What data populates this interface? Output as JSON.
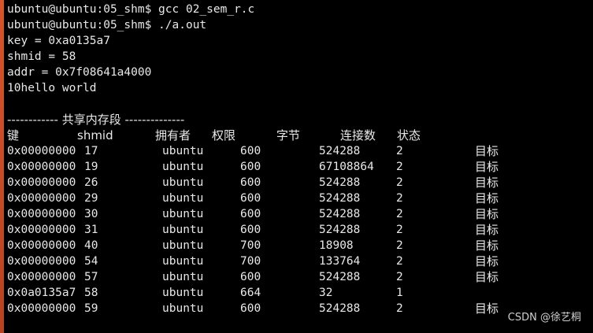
{
  "terminal": {
    "lines": [
      "ubuntu@ubuntu:05_shm$ gcc 02_sem_r.c",
      "ubuntu@ubuntu:05_shm$ ./a.out",
      "key = 0xa0135a7",
      "shmid = 58",
      "addr = 0x7f08641a4000",
      "10hello world",
      "",
      "------------ 共享内存段 --------------"
    ],
    "headers": {
      "key": "键",
      "shmid": "shmid",
      "owner": "拥有者",
      "perms": "权限",
      "bytes": "字节",
      "nattch": "连接数",
      "status": "状态"
    },
    "rows": [
      {
        "key": "0x00000000",
        "shmid": "17",
        "owner": "ubuntu",
        "perms": "600",
        "bytes": "524288",
        "nattch": "2",
        "status": "目标"
      },
      {
        "key": "0x00000000",
        "shmid": "19",
        "owner": "ubuntu",
        "perms": "600",
        "bytes": "67108864",
        "nattch": "2",
        "status": "目标"
      },
      {
        "key": "0x00000000",
        "shmid": "26",
        "owner": "ubuntu",
        "perms": "600",
        "bytes": "524288",
        "nattch": "2",
        "status": "目标"
      },
      {
        "key": "0x00000000",
        "shmid": "29",
        "owner": "ubuntu",
        "perms": "600",
        "bytes": "524288",
        "nattch": "2",
        "status": "目标"
      },
      {
        "key": "0x00000000",
        "shmid": "30",
        "owner": "ubuntu",
        "perms": "600",
        "bytes": "524288",
        "nattch": "2",
        "status": "目标"
      },
      {
        "key": "0x00000000",
        "shmid": "31",
        "owner": "ubuntu",
        "perms": "600",
        "bytes": "524288",
        "nattch": "2",
        "status": "目标"
      },
      {
        "key": "0x00000000",
        "shmid": "40",
        "owner": "ubuntu",
        "perms": "700",
        "bytes": "18908",
        "nattch": "2",
        "status": "目标"
      },
      {
        "key": "0x00000000",
        "shmid": "54",
        "owner": "ubuntu",
        "perms": "700",
        "bytes": "133764",
        "nattch": "2",
        "status": "目标"
      },
      {
        "key": "0x00000000",
        "shmid": "57",
        "owner": "ubuntu",
        "perms": "600",
        "bytes": "524288",
        "nattch": "2",
        "status": "目标"
      },
      {
        "key": "0x0a0135a7",
        "shmid": "58",
        "owner": "ubuntu",
        "perms": "664",
        "bytes": "32",
        "nattch": "1",
        "status": ""
      },
      {
        "key": "0x00000000",
        "shmid": "59",
        "owner": "ubuntu",
        "perms": "600",
        "bytes": "524288",
        "nattch": "2",
        "status": "目标"
      }
    ],
    "watermark": "CSDN @徐艺桐"
  },
  "colors": {
    "background": "#000000",
    "text": "#e8e8e8",
    "left_bar": "#d8542a"
  }
}
